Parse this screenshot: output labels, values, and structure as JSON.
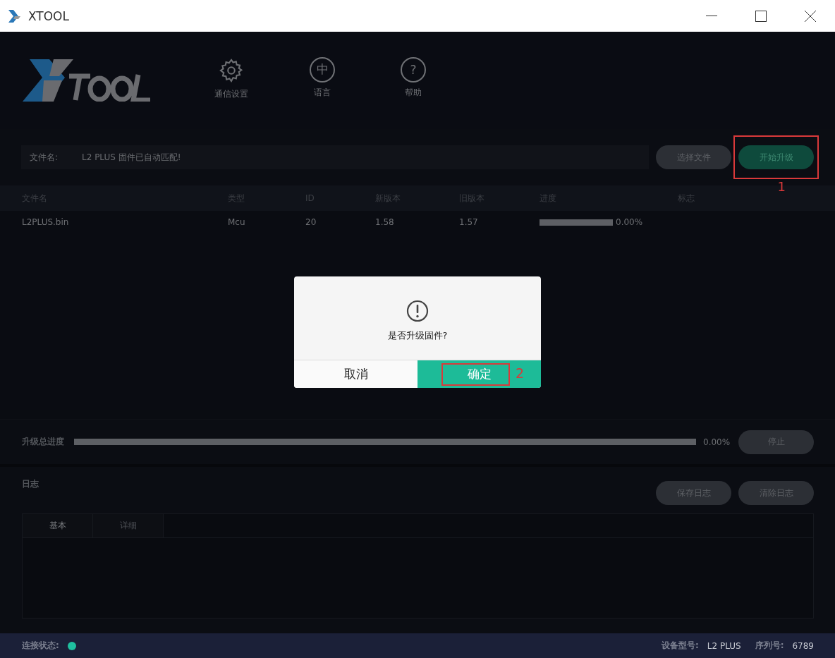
{
  "window": {
    "title": "XTOOL"
  },
  "toolbar": [
    {
      "kind": "gear",
      "label": "通信设置"
    },
    {
      "kind": "lang",
      "glyph": "中",
      "label": "语言"
    },
    {
      "kind": "help",
      "glyph": "?",
      "label": "帮助"
    }
  ],
  "file_bar": {
    "label": "文件名:",
    "value": "L2 PLUS 固件已自动匹配!",
    "buttons": [
      {
        "label": "选择文件",
        "kind": "plain"
      },
      {
        "label": "开始升级",
        "kind": "primary",
        "callout": "1"
      }
    ]
  },
  "table": {
    "columns": [
      "文件名",
      "类型",
      "ID",
      "新版本",
      "旧版本",
      "进度",
      "标志"
    ],
    "rows": [
      {
        "cells": [
          "L2PLUS.bin",
          "Mcu",
          "20",
          "1.58",
          "1.57"
        ],
        "progress": {
          "level": 0,
          "reading": "0.00%"
        }
      }
    ]
  },
  "total_progress": {
    "label": "升级总进度",
    "level": 0,
    "reading": "0.00%",
    "button": "停止"
  },
  "log": {
    "title": "日志",
    "buttons": [
      "保存日志",
      "清除日志"
    ],
    "tabs": [
      {
        "label": "基本",
        "selected": true
      },
      {
        "label": "详细",
        "selected": false
      }
    ]
  },
  "dialog": {
    "message": "是否升级固件?",
    "cancel": "取消",
    "confirm": "确定",
    "confirm_callout": "2"
  },
  "status_bar": {
    "connection_label": "连接状态:",
    "connected": true,
    "model_label": "设备型号:",
    "model": "L2 PLUS",
    "serial_label": "序列号:",
    "serial": "6789"
  }
}
